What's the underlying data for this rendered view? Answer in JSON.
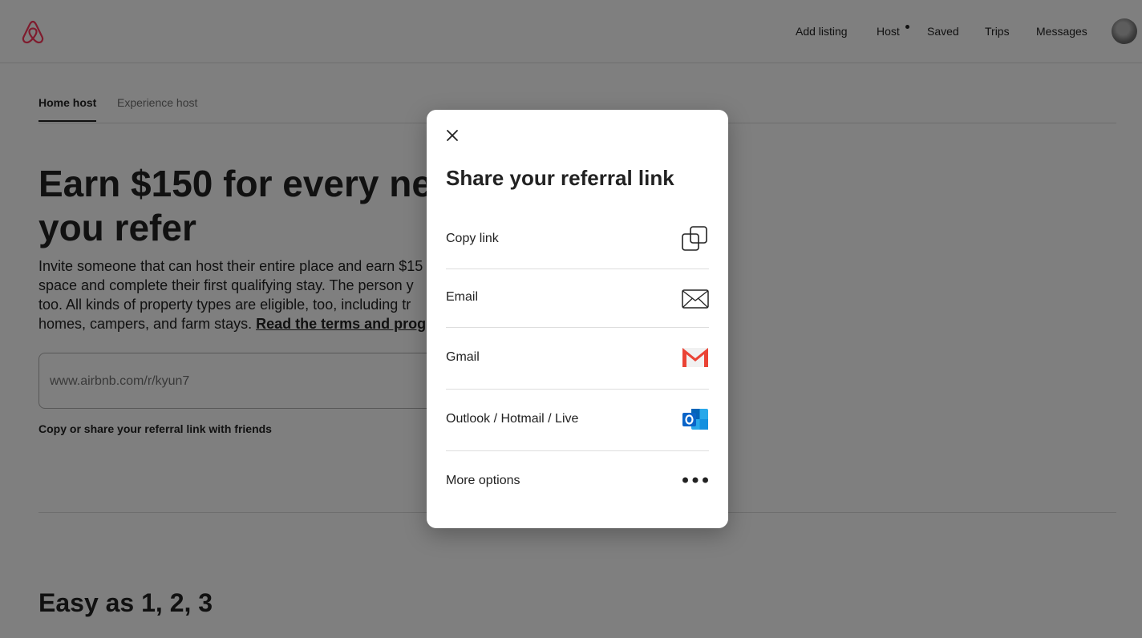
{
  "header": {
    "nav": [
      "Add listing",
      "Host",
      "Saved",
      "Trips",
      "Messages"
    ]
  },
  "tabs": [
    "Home host",
    "Experience host"
  ],
  "hero": {
    "headline_line1": "Earn $150 for every new",
    "headline_line2": "you refer",
    "desc_line1": "Invite someone that can host their entire place and earn $15",
    "desc_line2": "space and complete their first qualifying stay. The person y",
    "desc_line3": "too. All kinds of property types are eligible, too, including tr",
    "desc_line4_prefix": "homes, campers, and farm stays. ",
    "desc_link": "Read the terms and prog"
  },
  "referral": {
    "link_value": "www.airbnb.com/r/kyun7",
    "hint": "Copy or share your referral link with friends"
  },
  "section": {
    "title": "Easy as 1, 2, 3"
  },
  "modal": {
    "title": "Share your referral link",
    "options": [
      {
        "label": "Copy link",
        "icon": "copy-icon"
      },
      {
        "label": "Email",
        "icon": "envelope-icon"
      },
      {
        "label": "Gmail",
        "icon": "gmail-icon"
      },
      {
        "label": "Outlook / Hotmail / Live",
        "icon": "outlook-icon"
      },
      {
        "label": "More options",
        "icon": "more-icon"
      }
    ]
  },
  "colors": {
    "brand": "#FF385C",
    "gmail_red": "#EA4335",
    "outlook_blue": "#0A64C8"
  }
}
